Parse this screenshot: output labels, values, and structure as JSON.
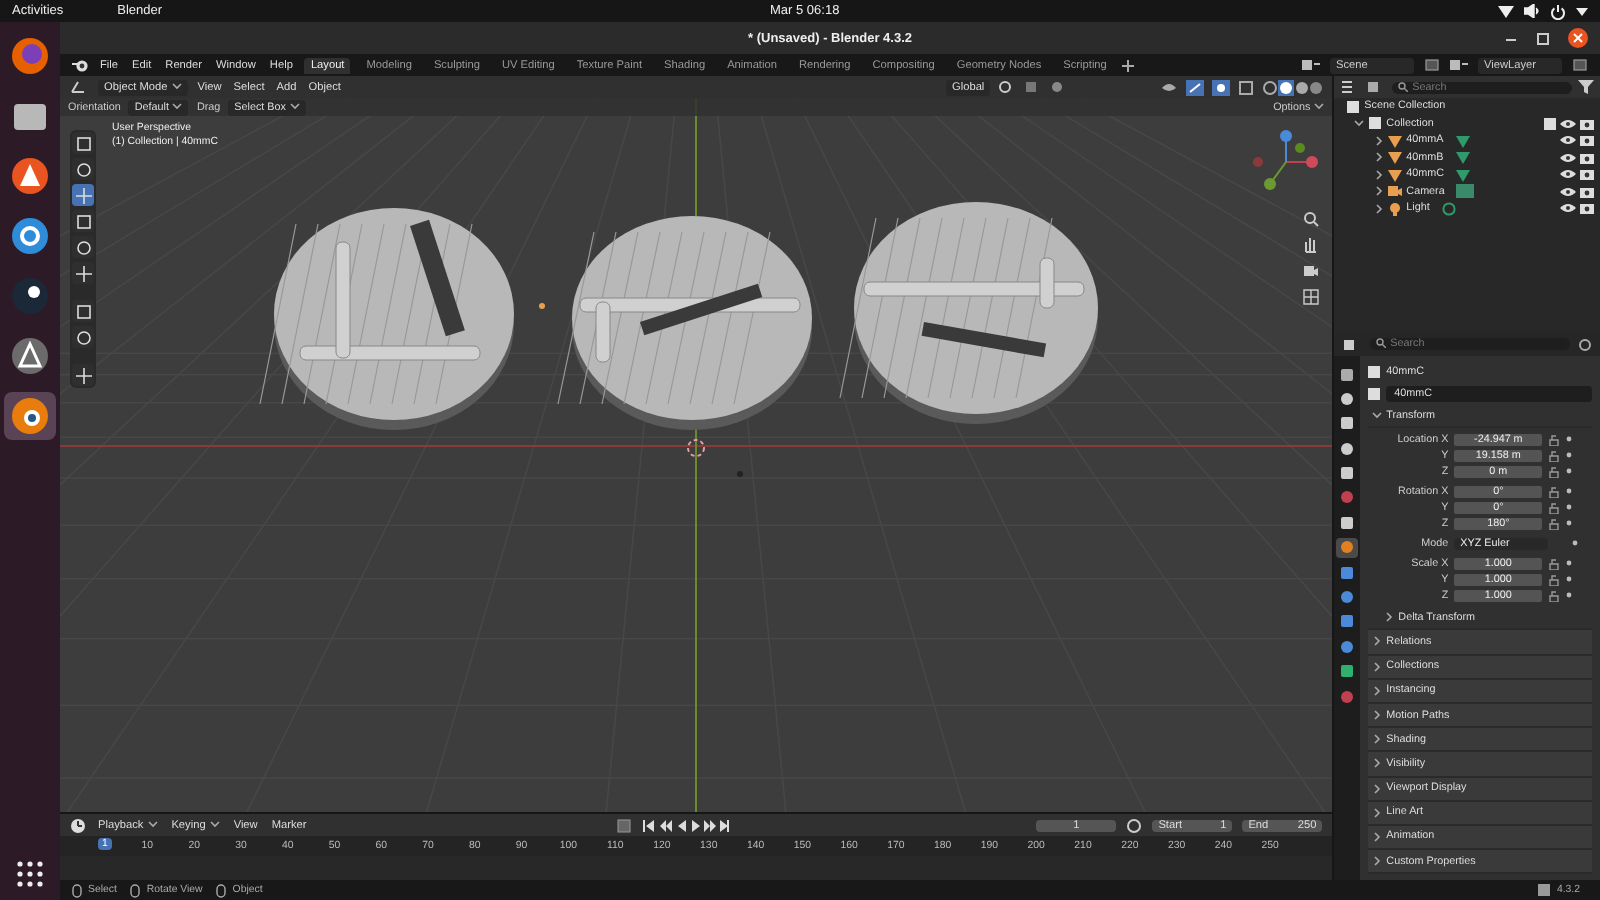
{
  "system_bar": {
    "activities": "Activities",
    "app": "Blender",
    "clock": "Mar 5  06:18"
  },
  "dock": [
    {
      "selected": false
    },
    {
      "selected": false
    },
    {
      "selected": false
    },
    {
      "selected": false
    },
    {
      "selected": false
    },
    {
      "selected": false
    },
    {
      "selected": true
    }
  ],
  "window": {
    "title": "* (Unsaved) - Blender 4.3.2"
  },
  "menus": [
    "File",
    "Edit",
    "Render",
    "Window",
    "Help"
  ],
  "workspaces": [
    {
      "label": "Layout",
      "selected": true
    },
    {
      "label": "Modeling",
      "selected": false
    },
    {
      "label": "Sculpting",
      "selected": false
    },
    {
      "label": "UV Editing",
      "selected": false
    },
    {
      "label": "Texture Paint",
      "selected": false
    },
    {
      "label": "Shading",
      "selected": false
    },
    {
      "label": "Animation",
      "selected": false
    },
    {
      "label": "Rendering",
      "selected": false
    },
    {
      "label": "Compositing",
      "selected": false
    },
    {
      "label": "Geometry Nodes",
      "selected": false
    },
    {
      "label": "Scripting",
      "selected": false
    }
  ],
  "scene": "Scene",
  "view_layer": "ViewLayer",
  "viewport": {
    "mode": "Object Mode",
    "menus": [
      "View",
      "Select",
      "Add",
      "Object"
    ],
    "transform_orientation": "Global",
    "orientation_label": "Orientation",
    "orientation": "Default",
    "drag_label": "Drag",
    "drag": "Select Box",
    "options": "Options",
    "info": [
      "User Perspective",
      "(1) Collection | 40mmC"
    ],
    "tools": [
      {
        "selected": false
      },
      {
        "selected": false
      },
      {
        "selected": true
      },
      {
        "selected": false
      },
      {
        "selected": false
      },
      {
        "selected": false
      },
      {
        "selected": false
      },
      {
        "selected": false
      },
      {
        "selected": false
      }
    ]
  },
  "outliner": {
    "search_placeholder": "Search",
    "root": "Scene Collection",
    "items": [
      {
        "label": "Collection",
        "kind": "collection",
        "expanded": true,
        "children": [
          {
            "label": "40mmA",
            "kind": "mesh",
            "expanded": false
          },
          {
            "label": "40mmB",
            "kind": "mesh",
            "expanded": false
          },
          {
            "label": "40mmC",
            "kind": "mesh",
            "expanded": false
          },
          {
            "label": "Camera",
            "kind": "camera",
            "expanded": false
          },
          {
            "label": "Light",
            "kind": "light",
            "expanded": false
          }
        ]
      }
    ]
  },
  "properties": {
    "search_placeholder": "Search",
    "tabs": [
      {
        "selected": false
      },
      {
        "selected": false
      },
      {
        "selected": false
      },
      {
        "selected": false
      },
      {
        "selected": false
      },
      {
        "selected": false
      },
      {
        "selected": false
      },
      {
        "selected": true
      },
      {
        "selected": false
      },
      {
        "selected": false
      },
      {
        "selected": false
      },
      {
        "selected": false
      },
      {
        "selected": false
      },
      {
        "selected": false
      }
    ],
    "object": "40mmC",
    "data_name": "40mmC",
    "transform": {
      "title": "Transform",
      "expanded": true,
      "groups": [
        [
          {
            "kind": "field",
            "label": "Location X",
            "value": "-24.947 m"
          },
          {
            "kind": "field",
            "label": "Y",
            "value": "19.158 m"
          },
          {
            "kind": "field",
            "label": "Z",
            "value": "0 m"
          }
        ],
        [
          {
            "kind": "field",
            "label": "Rotation X",
            "value": "0°"
          },
          {
            "kind": "field",
            "label": "Y",
            "value": "0°"
          },
          {
            "kind": "field",
            "label": "Z",
            "value": "180°"
          }
        ],
        [
          {
            "kind": "dropdown",
            "label": "Mode",
            "value": "XYZ Euler"
          }
        ],
        [
          {
            "kind": "field",
            "label": "Scale X",
            "value": "1.000"
          },
          {
            "kind": "field",
            "label": "Y",
            "value": "1.000"
          },
          {
            "kind": "field",
            "label": "Z",
            "value": "1.000"
          }
        ]
      ]
    },
    "panels": [
      {
        "label": "Delta Transform",
        "kind": "subpanel",
        "expanded": false
      },
      {
        "label": "Relations",
        "kind": "panel",
        "expanded": false
      },
      {
        "label": "Collections",
        "kind": "panel",
        "expanded": false
      },
      {
        "label": "Instancing",
        "kind": "panel",
        "expanded": false
      },
      {
        "label": "Motion Paths",
        "kind": "panel",
        "expanded": false
      },
      {
        "label": "Shading",
        "kind": "panel",
        "expanded": false
      },
      {
        "label": "Visibility",
        "kind": "panel",
        "expanded": false
      },
      {
        "label": "Viewport Display",
        "kind": "panel",
        "expanded": false
      },
      {
        "label": "Line Art",
        "kind": "panel",
        "expanded": false
      },
      {
        "label": "Animation",
        "kind": "panel",
        "expanded": false
      },
      {
        "label": "Custom Properties",
        "kind": "panel",
        "expanded": false
      }
    ]
  },
  "timeline": {
    "menus": [
      "Playback",
      "Keying",
      "View",
      "Marker"
    ],
    "current_frame": "1",
    "start_label": "Start",
    "start": "1",
    "end_label": "End",
    "end": "250",
    "playhead": "1",
    "ruler": [
      "10",
      "20",
      "30",
      "40",
      "50",
      "60",
      "70",
      "80",
      "90",
      "100",
      "110",
      "120",
      "130",
      "140",
      "150",
      "160",
      "170",
      "180",
      "190",
      "200",
      "210",
      "220",
      "230",
      "240",
      "250"
    ]
  },
  "status_bar": {
    "hints": [
      "Select",
      "Rotate View",
      "Object"
    ],
    "version": "4.3.2"
  }
}
